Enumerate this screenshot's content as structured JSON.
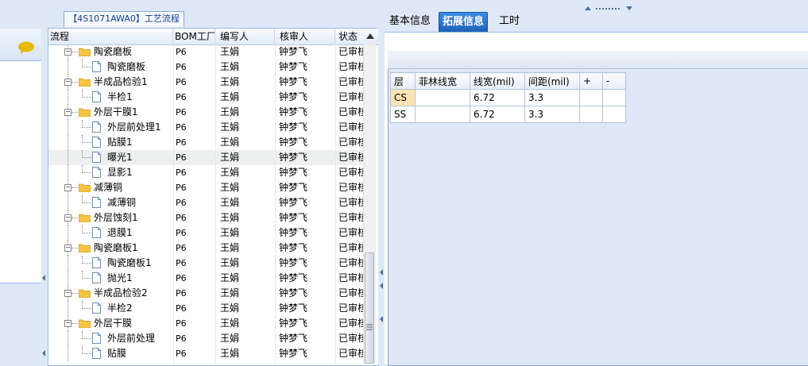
{
  "tree_panel": {
    "tab_title": "【4S1071AWA0】工艺流程",
    "columns": [
      "流程",
      "BOM工厂",
      "编写人",
      "核审人",
      "状态"
    ],
    "rows": [
      {
        "level": 1,
        "type": "folder",
        "name": "陶瓷磨板",
        "bom": "P6",
        "writer": "王娟",
        "reviewer": "钟梦飞",
        "status": "已审核"
      },
      {
        "level": 2,
        "type": "doc",
        "name": "陶瓷磨板",
        "bom": "P6",
        "writer": "王娟",
        "reviewer": "钟梦飞",
        "status": "已审核"
      },
      {
        "level": 1,
        "type": "folder",
        "name": "半成品检验1",
        "bom": "P6",
        "writer": "王娟",
        "reviewer": "钟梦飞",
        "status": "已审核"
      },
      {
        "level": 2,
        "type": "doc",
        "name": "半检1",
        "bom": "P6",
        "writer": "王娟",
        "reviewer": "钟梦飞",
        "status": "已审核"
      },
      {
        "level": 1,
        "type": "folder",
        "name": "外层干膜1",
        "bom": "P6",
        "writer": "王娟",
        "reviewer": "钟梦飞",
        "status": "已审核"
      },
      {
        "level": 2,
        "type": "doc",
        "name": "外层前处理1",
        "bom": "P6",
        "writer": "王娟",
        "reviewer": "钟梦飞",
        "status": "已审核"
      },
      {
        "level": 2,
        "type": "doc",
        "name": "贴膜1",
        "bom": "P6",
        "writer": "王娟",
        "reviewer": "钟梦飞",
        "status": "已审核"
      },
      {
        "level": 2,
        "type": "doc",
        "name": "曝光1",
        "bom": "P6",
        "writer": "王娟",
        "reviewer": "钟梦飞",
        "status": "已审核",
        "selected": true
      },
      {
        "level": 2,
        "type": "doc",
        "name": "显影1",
        "bom": "P6",
        "writer": "王娟",
        "reviewer": "钟梦飞",
        "status": "已审核"
      },
      {
        "level": 1,
        "type": "folder",
        "name": "减薄铜",
        "bom": "P6",
        "writer": "王娟",
        "reviewer": "钟梦飞",
        "status": "已审核"
      },
      {
        "level": 2,
        "type": "doc",
        "name": "减薄铜",
        "bom": "P6",
        "writer": "王娟",
        "reviewer": "钟梦飞",
        "status": "已审核"
      },
      {
        "level": 1,
        "type": "folder",
        "name": "外层蚀刻1",
        "bom": "P6",
        "writer": "王娟",
        "reviewer": "钟梦飞",
        "status": "已审核"
      },
      {
        "level": 2,
        "type": "doc",
        "name": "退膜1",
        "bom": "P6",
        "writer": "王娟",
        "reviewer": "钟梦飞",
        "status": "已审核"
      },
      {
        "level": 1,
        "type": "folder",
        "name": "陶瓷磨板1",
        "bom": "P6",
        "writer": "王娟",
        "reviewer": "钟梦飞",
        "status": "已审核"
      },
      {
        "level": 2,
        "type": "doc",
        "name": "陶瓷磨板1",
        "bom": "P6",
        "writer": "王娟",
        "reviewer": "钟梦飞",
        "status": "已审核"
      },
      {
        "level": 2,
        "type": "doc",
        "name": "抛光1",
        "bom": "P6",
        "writer": "王娟",
        "reviewer": "钟梦飞",
        "status": "已审核"
      },
      {
        "level": 1,
        "type": "folder",
        "name": "半成品检验2",
        "bom": "P6",
        "writer": "王娟",
        "reviewer": "钟梦飞",
        "status": "已审核"
      },
      {
        "level": 2,
        "type": "doc",
        "name": "半检2",
        "bom": "P6",
        "writer": "王娟",
        "reviewer": "钟梦飞",
        "status": "已审核"
      },
      {
        "level": 1,
        "type": "folder",
        "name": "外层干膜",
        "bom": "P6",
        "writer": "王娟",
        "reviewer": "钟梦飞",
        "status": "已审核"
      },
      {
        "level": 2,
        "type": "doc",
        "name": "外层前处理",
        "bom": "P6",
        "writer": "王娟",
        "reviewer": "钟梦飞",
        "status": "已审核"
      },
      {
        "level": 2,
        "type": "doc",
        "name": "贴膜",
        "bom": "P6",
        "writer": "王娟",
        "reviewer": "钟梦飞",
        "status": "已审核"
      }
    ]
  },
  "right_panel": {
    "tabs": [
      {
        "label": "基本信息",
        "active": false
      },
      {
        "label": "拓展信息",
        "active": true
      },
      {
        "label": "工时",
        "active": false
      }
    ],
    "table": {
      "headers": [
        "层",
        "菲林线宽",
        "线宽(mil)",
        "间距(mil)",
        "+",
        "-"
      ],
      "rows": [
        [
          "CS",
          "",
          "6.72",
          "3.3",
          "",
          ""
        ],
        [
          "SS",
          "",
          "6.72",
          "3.3",
          "",
          ""
        ]
      ]
    }
  },
  "icons": {
    "chat": "chat-bubble-icon",
    "folder": "folder-icon",
    "document": "document-icon",
    "collapse": "minus-box-icon",
    "scroll_up": "arrow-up-icon",
    "grip": "grip-dots-icon"
  },
  "colors": {
    "accent": "#1e62b8",
    "frame": "#dfe8f6",
    "highlight_cell": "#fde3b4",
    "chat_icon": "#e5b80b"
  }
}
